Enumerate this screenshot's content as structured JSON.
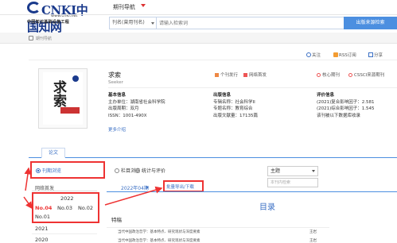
{
  "header": {
    "logo_text": "CNKI中国知网",
    "logo_url": "www.cnki.net",
    "logo_sub": "中国知识基础设施工程",
    "nav_title": "期刊导航",
    "search_select": "刊名(曾用刊名)",
    "search_placeholder": "请输入检索词",
    "search_button": "出版来源检索"
  },
  "breadcrumb": "期刊导航",
  "top_actions": [
    {
      "label": "关注",
      "icon": "star-icon"
    },
    {
      "label": "RSS订阅",
      "icon": "rss-icon"
    },
    {
      "label": "分享",
      "icon": "share-icon"
    }
  ],
  "journal": {
    "title": "求索",
    "cover_title": "求索",
    "subtitle": "Seeker",
    "badges": [
      {
        "label": "个刊发行",
        "icon": "ticket-icon"
      },
      {
        "label": "网络首发",
        "icon": "network-icon"
      },
      {
        "label": "核心期刊",
        "icon": "core-icon"
      },
      {
        "label": "CSSCI来源期刊",
        "icon": "cssci-icon"
      }
    ],
    "basic_info_head": "基本信息",
    "basic_info": [
      "主办单位：湖南省社会科学院",
      "出版周期：双月",
      "ISSN：1001-490X"
    ],
    "publish_info_head": "出版信息",
    "publish_info": [
      "专辑名称：社会科学II",
      "专题名称：教育综合",
      "出版文献量：17135篇"
    ],
    "eval_info_head": "评价信息",
    "eval_info": [
      "(2021)复合影响因子：2.581",
      "(2021)综合影响因子：1.545",
      "该刊被以下数据库收录"
    ],
    "more_link": "更多介绍"
  },
  "tabs": {
    "paper_tab": "论文",
    "radios": [
      {
        "label": "刊期浏览",
        "selected": true
      },
      {
        "label": "栏目浏览",
        "selected": false
      },
      {
        "label": "统计与评价",
        "selected": false
      }
    ],
    "topic_select": "主题",
    "issue_search_placeholder": "本刊内检索"
  },
  "years": {
    "head": "网络首发",
    "selected_year": "2022",
    "issues": [
      "No.04",
      "No.03",
      "No.02",
      "No.01"
    ],
    "others": [
      "2021",
      "2020"
    ]
  },
  "issue": {
    "current": "2022年04期",
    "download_link": "批量导出/下载",
    "mulu": "目录",
    "section": "特稿",
    "articles": [
      {
        "title": "当代中国政治哲学：基本特点、研究现状与深度要素",
        "author": "王岩"
      },
      {
        "title": "当代中国政治哲学：基本特点、研究现状与深度要素",
        "author": "王岩"
      }
    ]
  }
}
